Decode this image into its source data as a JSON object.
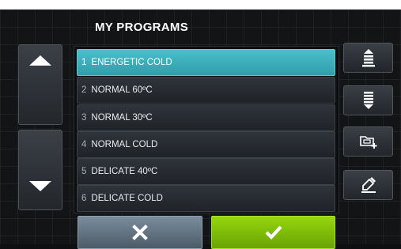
{
  "header": {
    "title": "MY PROGRAMS"
  },
  "programs": [
    {
      "number": "1",
      "name": "ENERGETIC COLD",
      "selected": true
    },
    {
      "number": "2",
      "name": "NORMAL 60ºC",
      "selected": false
    },
    {
      "number": "3",
      "name": "NORMAL 30ºC",
      "selected": false
    },
    {
      "number": "4",
      "name": "NORMAL COLD",
      "selected": false
    },
    {
      "number": "5",
      "name": "DELICATE 40ºC",
      "selected": false
    },
    {
      "number": "6",
      "name": "DELICATE COLD",
      "selected": false
    }
  ],
  "icons": {
    "scroll_up": "triangle-up-icon",
    "scroll_down": "triangle-down-icon",
    "move_up": "stack-arrow-up-icon",
    "move_down": "stack-arrow-down-icon",
    "add": "folder-add-icon",
    "edit": "pencil-icon",
    "cancel": "x-icon",
    "confirm": "checkmark-icon"
  },
  "colors": {
    "selected_row": "#3fb2bd",
    "confirm_button": "#82c00c",
    "cancel_button": "#62737f"
  }
}
